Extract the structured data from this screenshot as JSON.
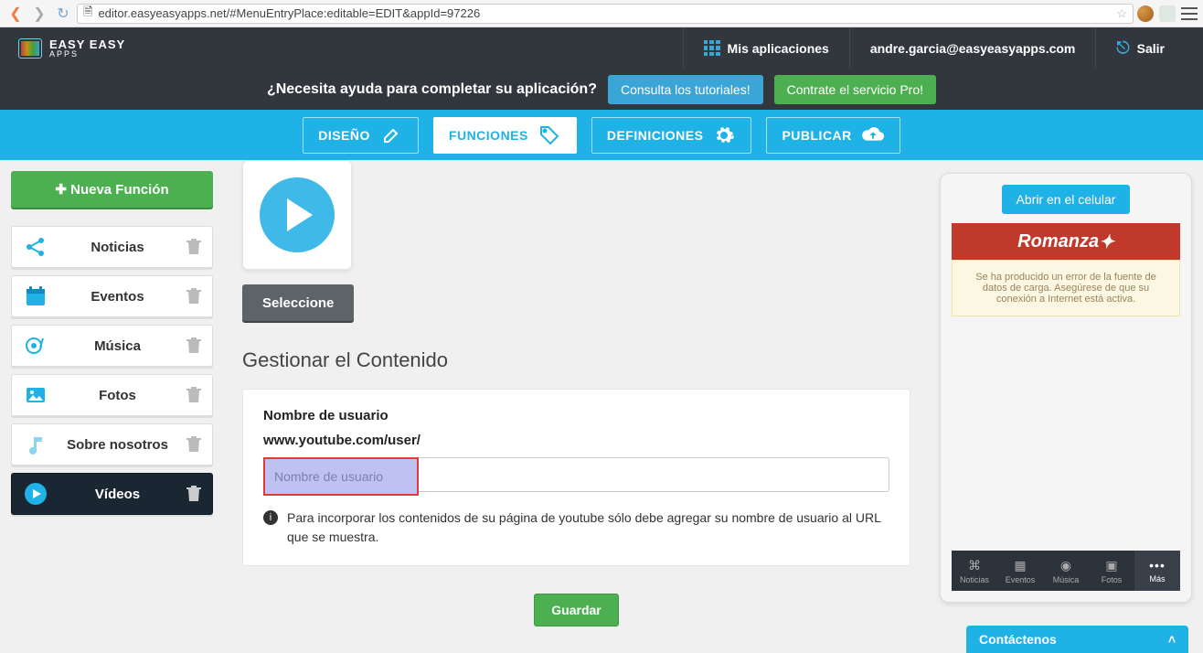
{
  "browser": {
    "url": "editor.easyeasyapps.net/#MenuEntryPlace:editable=EDIT&appId=97226"
  },
  "logo": {
    "line1": "EASY EASY",
    "line2": "APPS"
  },
  "top": {
    "my_apps": "Mis aplicaciones",
    "user": "andre.garcia@easyeasyapps.com",
    "exit": "Salir"
  },
  "help": {
    "question": "¿Necesita ayuda para completar su aplicación?",
    "tutorials": "Consulta los tutoriales!",
    "pro": "Contrate el servicio Pro!"
  },
  "tabs": {
    "design": "DISEÑO",
    "functions": "FUNCIONES",
    "definitions": "DEFINICIONES",
    "publish": "PUBLICAR"
  },
  "sidebar": {
    "new_function": "Nueva Función",
    "items": [
      {
        "label": "Noticias"
      },
      {
        "label": "Eventos"
      },
      {
        "label": "Música"
      },
      {
        "label": "Fotos"
      },
      {
        "label": "Sobre nosotros"
      },
      {
        "label": "Vídeos"
      }
    ]
  },
  "content": {
    "select": "Seleccione",
    "section": "Gestionar el Contenido",
    "field_label": "Nombre de usuario",
    "url_prefix": "www.youtube.com/user/",
    "placeholder": "Nombre de usuario",
    "hint": "Para incorporar los contenidos de su página de youtube sólo debe agregar su nombre de usuario al URL que se muestra.",
    "save": "Guardar"
  },
  "preview": {
    "open": "Abrir en el celular",
    "app_title": "Romanza",
    "error": "Se ha producido un error de la fuente de datos de carga. Asegúrese de que su conexión a Internet está activa.",
    "footer": {
      "news": "Noticias",
      "events": "Eventos",
      "music": "Música",
      "photos": "Fotos",
      "more": "Más"
    }
  },
  "contact": "Contáctenos"
}
